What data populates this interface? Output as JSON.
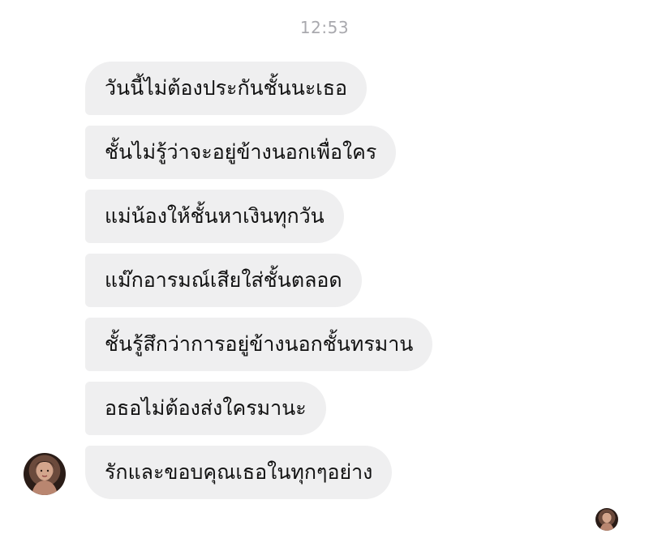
{
  "timestamp": "12:53",
  "messages": [
    "วันนี้ไม่ต้องประกันชั้นนะเธอ",
    "ชั้นไม่รู้ว่าจะอยู่ข้างนอกเพื่อใคร",
    "แม่น้องให้ชั้นหาเงินทุกวัน",
    "แม๊กอารมณ์เสียใส่ชั้นตลอด",
    "ชั้นรู้สึกว่าการอยู่ข้างนอกชั้นทรมาน",
    "อธอไม่ต้องส่งใครมานะ",
    "รักและขอบคุณเธอในทุกๆอย่าง"
  ],
  "colors": {
    "bubble": "#efeff0",
    "text": "#111111",
    "timestamp": "#a9a9ae",
    "background": "#ffffff"
  },
  "icons": {
    "sender_avatar": "profile-photo",
    "read_receipt": "seen-avatar"
  }
}
